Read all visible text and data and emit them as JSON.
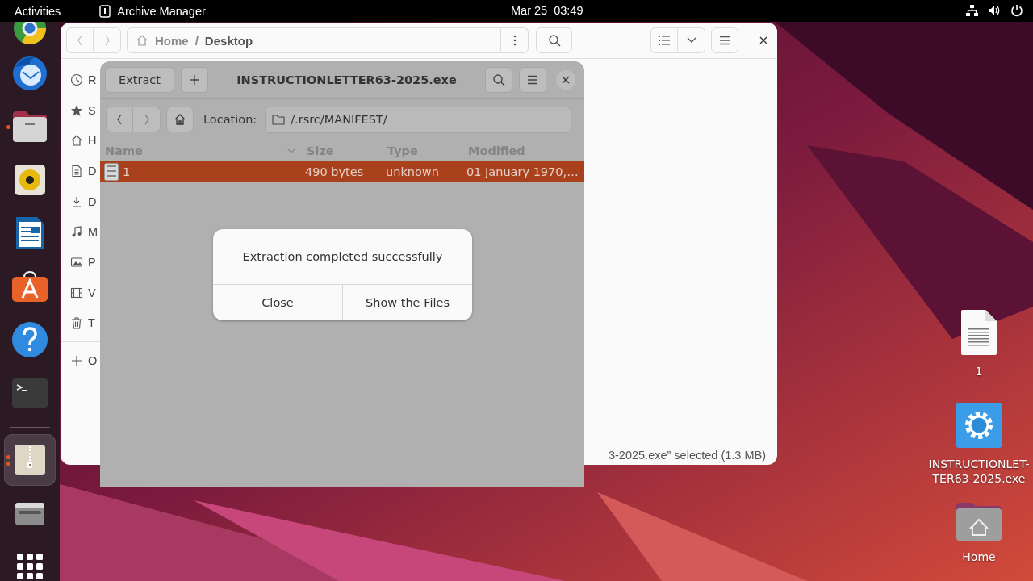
{
  "top_bar": {
    "activities": "Activities",
    "app_name": "Archive Manager",
    "clock": "Mar 25  03:49"
  },
  "dock": {
    "favorites": [
      {
        "kind": "chrome",
        "running": false,
        "selected": false
      },
      {
        "kind": "mail",
        "running": false,
        "selected": false
      },
      {
        "kind": "files",
        "running": true,
        "multiple": false,
        "selected": false
      },
      {
        "kind": "music",
        "running": false,
        "selected": false
      },
      {
        "kind": "writer",
        "running": false,
        "selected": false
      },
      {
        "kind": "store",
        "running": false,
        "selected": false
      },
      {
        "kind": "help",
        "running": false,
        "selected": false
      },
      {
        "kind": "terminal",
        "running": false,
        "selected": false
      }
    ],
    "others": [
      {
        "kind": "archive",
        "running": true,
        "multiple": true,
        "selected": true
      },
      {
        "kind": "drive",
        "running": false,
        "selected": false
      }
    ]
  },
  "files_window": {
    "path": [
      "Home",
      "Desktop"
    ],
    "path_separator": "/",
    "sidebar": [
      {
        "kind": "recent",
        "label": "R"
      },
      {
        "kind": "star",
        "label": "S"
      },
      {
        "kind": "home",
        "label": "H"
      },
      {
        "kind": "document",
        "label": "D"
      },
      {
        "kind": "download",
        "label": "D"
      },
      {
        "kind": "music",
        "label": "M"
      },
      {
        "kind": "picture",
        "label": "P"
      },
      {
        "kind": "video",
        "label": "V"
      },
      {
        "kind": "trash",
        "label": "T"
      }
    ],
    "other": {
      "label": "O"
    },
    "status": "3-2025.exe” selected (1.3 MB)"
  },
  "archive_window": {
    "extract_button": "Extract",
    "title": "INSTRUCTIONLETTER63-2025.exe",
    "location_label": "Location:",
    "location": "/.rsrc/MANIFEST/",
    "columns": [
      "Name",
      "Size",
      "Type",
      "Modified"
    ],
    "rows": [
      {
        "name": "1",
        "size": "490 bytes",
        "type": "unknown",
        "modified": "01 January 1970,…",
        "selected": true
      }
    ]
  },
  "dialog": {
    "message": "Extraction completed successfully",
    "buttons": [
      "Close",
      "Show the Files"
    ]
  },
  "desktop_icons": [
    {
      "kind": "text-file",
      "label": [
        "1"
      ]
    },
    {
      "kind": "executable",
      "label": [
        "INSTRUCTIONLET-",
        "TER63-2025.exe"
      ]
    },
    {
      "kind": "home",
      "label": [
        "Home"
      ]
    }
  ]
}
